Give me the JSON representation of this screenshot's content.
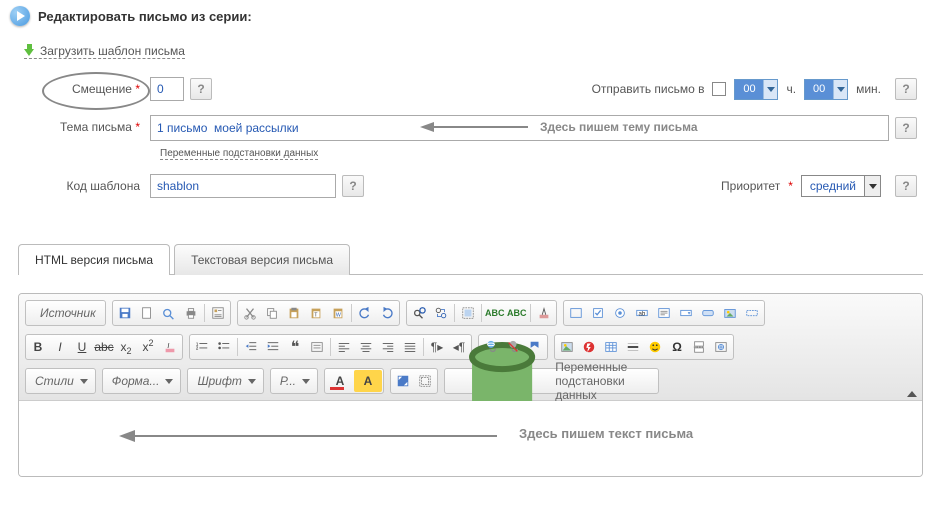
{
  "header": {
    "title": "Редактировать письмо из серии:"
  },
  "load_template_link": "Загрузить шаблон письма",
  "offset": {
    "label": "Смещение",
    "value": "0",
    "help": "?"
  },
  "send_at": {
    "label": "Отправить письмо в",
    "checked": false,
    "hour": "00",
    "hour_suffix": "ч.",
    "minute": "00",
    "minute_suffix": "мин.",
    "help": "?"
  },
  "subject": {
    "label": "Тема письма",
    "value": "1 письмо  моей рассылки",
    "annotation": "Здесь пишем тему  письма",
    "vars_link": "Переменные подстановки данных",
    "help": "?"
  },
  "template_code": {
    "label": "Код шаблона",
    "value": "shablon",
    "help": "?"
  },
  "priority": {
    "label": "Приоритет",
    "value": "средний",
    "help": "?"
  },
  "tabs": {
    "html": "HTML версия письма",
    "text": "Текстовая версия письма"
  },
  "editor": {
    "source_btn": "Источник",
    "styles": "Стили",
    "format": "Форма...",
    "font": "Шрифт",
    "size": "Р...",
    "vars_btn": "Переменные подстановки данных",
    "annotation": "Здесь пишем  текст письма",
    "bold": "B",
    "italic": "I",
    "underline": "U",
    "abc": "abc",
    "x2": "x",
    "sq": "2"
  }
}
